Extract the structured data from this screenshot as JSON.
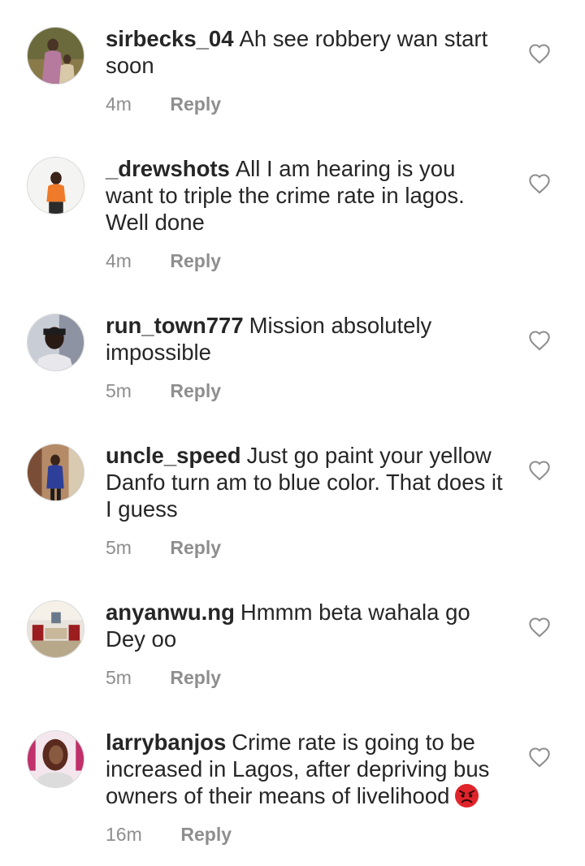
{
  "comments": [
    {
      "username": "sirbecks_04",
      "text": "Ah see robbery wan start soon",
      "time": "4m",
      "reply_label": "Reply",
      "avatar_icon": "user-photo-avatar"
    },
    {
      "username": "_drewshots",
      "text": "All I am hearing is you want to triple the crime rate in lagos. Well done",
      "time": "4m",
      "reply_label": "Reply",
      "avatar_icon": "user-photo-avatar"
    },
    {
      "username": "run_town777",
      "text": "Mission absolutely impossible",
      "time": "5m",
      "reply_label": "Reply",
      "avatar_icon": "user-photo-avatar"
    },
    {
      "username": "uncle_speed",
      "text": "Just go paint your yellow Danfo turn am to blue color. That does it I guess",
      "time": "5m",
      "reply_label": "Reply",
      "avatar_icon": "user-photo-avatar"
    },
    {
      "username": "anyanwu.ng",
      "text": "Hmmm beta wahala go Dey oo",
      "time": "5m",
      "reply_label": "Reply",
      "avatar_icon": "user-photo-avatar"
    },
    {
      "username": "larrybanjos",
      "text": "Crime rate is going to be increased in Lagos, after depriving bus owners of their means of livelihood",
      "emoji": "angry-face-emoji",
      "time": "16m",
      "reply_label": "Reply",
      "avatar_icon": "user-photo-avatar"
    }
  ],
  "like_icon": "heart-outline-icon",
  "colors": {
    "text": "#262626",
    "meta": "#8e8e8e",
    "background": "#ffffff",
    "emoji_red": "#e0242b"
  }
}
